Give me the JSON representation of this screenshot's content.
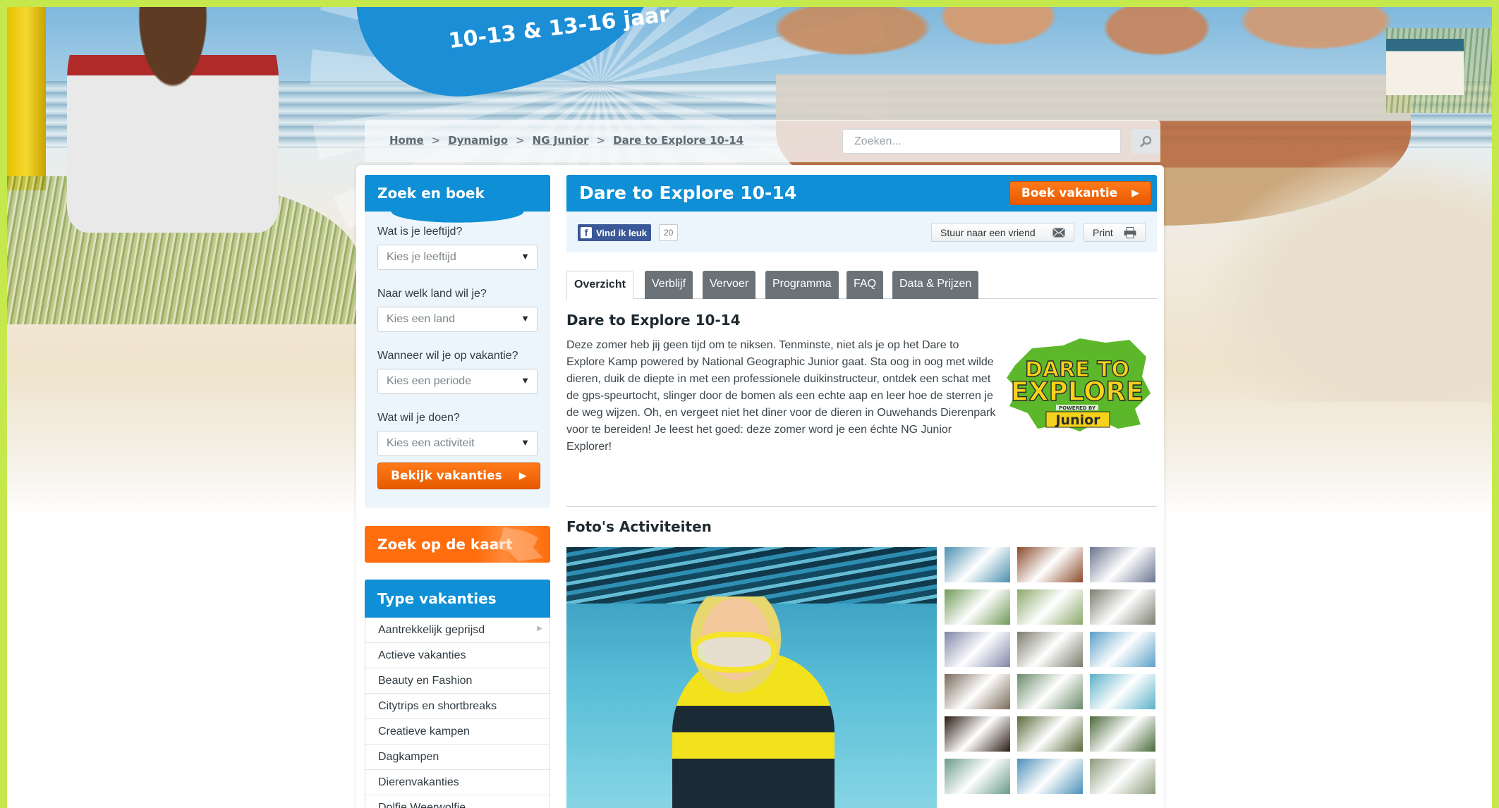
{
  "header": {
    "logo_text": "10-13 & 13-16 jaar"
  },
  "breadcrumb": [
    {
      "label": "Home"
    },
    {
      "label": "Dynamigo"
    },
    {
      "label": "NG Junior"
    },
    {
      "label": "Dare to Explore 10-14"
    }
  ],
  "search": {
    "placeholder": "Zoeken...",
    "icon": "magnifier-icon"
  },
  "sidebar": {
    "zoek_en_boek": {
      "title": "Zoek en boek",
      "fields": [
        {
          "label": "Wat is je leeftijd?",
          "value": "Kies je leeftijd"
        },
        {
          "label": "Naar welk land wil je?",
          "value": "Kies een land"
        },
        {
          "label": "Wanneer wil je op vakantie?",
          "value": "Kies een periode"
        },
        {
          "label": "Wat wil je doen?",
          "value": "Kies een activiteit"
        }
      ],
      "button": "Bekijk vakanties"
    },
    "kaart": {
      "title": "Zoek op de kaart"
    },
    "type_vakanties": {
      "title": "Type vakanties",
      "items": [
        "Aantrekkelijk geprijsd",
        "Actieve vakanties",
        "Beauty en Fashion",
        "Citytrips en shortbreaks",
        "Creatieve kampen",
        "Dagkampen",
        "Dierenvakanties",
        "Dolfje Weerwolfje"
      ]
    }
  },
  "main": {
    "title": "Dare to Explore 10-14",
    "boek_button": "Boek vakantie",
    "social": {
      "fb_like": "Vind ik leuk",
      "fb_count": "20",
      "send_label": "Stuur naar een vriend",
      "print_label": "Print"
    },
    "tabs": [
      {
        "label": "Overzicht",
        "active": true
      },
      {
        "label": "Verblijf",
        "active": false
      },
      {
        "label": "Vervoer",
        "active": false
      },
      {
        "label": "Programma",
        "active": false
      },
      {
        "label": "FAQ",
        "active": false
      },
      {
        "label": "Data & Prijzen",
        "active": false
      }
    ],
    "content_title": "Dare to Explore 10-14",
    "content_text": "Deze zomer heb jij geen tijd om te niksen. Tenminste, niet als je op het Dare to Explore Kamp powered by National Geographic Junior gaat. Sta oog in oog met wilde dieren, duik de diepte in met een professionele duikinstructeur, ontdek een schat met de gps-speurtocht, slinger door de bomen als een echte aap en leer hoe de sterren je de weg wijzen. Oh, en vergeet niet het diner voor de dieren in Ouwehands Dierenpark voor te bereiden! Je leest het goed: deze zomer word je een échte NG Junior Explorer!",
    "logo": {
      "line1": "DARE TO",
      "line2": "EXPLORE",
      "powered": "POWERED BY",
      "brand": "Junior"
    },
    "fotos_title": "Foto's Activiteiten",
    "thumbnail_colors": [
      "#4a8fb0",
      "#8a4a2a",
      "#6a7590",
      "#6f9a58",
      "#8aa86a",
      "#7c7f70",
      "#7f86a8",
      "#7a7a6a",
      "#5aa0c8",
      "#7a6a5a",
      "#6a8a6a",
      "#5ab0c8",
      "#2a1a10",
      "#5a6a3a",
      "#4a6a3a",
      "#6a9a8a",
      "#4a90b8",
      "#8a9a7a"
    ]
  },
  "colors": {
    "primary_blue": "#0e8fd6",
    "accent_orange": "#ff6d0c",
    "frame_green": "#c5e84d"
  }
}
